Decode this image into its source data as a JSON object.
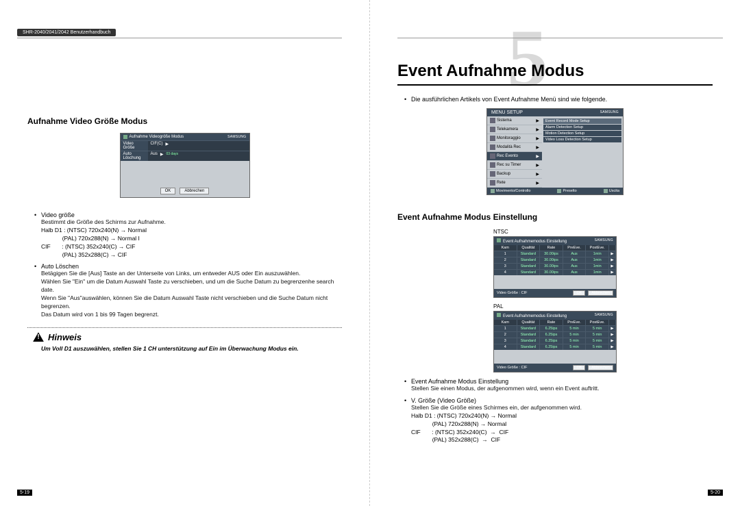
{
  "doc": {
    "header_label": "SHR-2040/2041/2042 Benutzerhandbuch",
    "chapter_number": "5",
    "chapter_title": "Event Aufnahme Modus",
    "page_left": "5-19",
    "page_right": "5-20"
  },
  "left": {
    "section1": "Aufnahme Video Größe Modus",
    "mock": {
      "title_icon": "rec-icon",
      "title": "Aufnahme Videogröße Modus",
      "brand": "SAMSUNG",
      "rows": [
        {
          "label": "Video Größe",
          "value": "CIF(C)",
          "arrow": "▶"
        },
        {
          "label": "Auto Löschung",
          "value": "Aus",
          "extra": "03 days",
          "arrow": "▶"
        }
      ],
      "ok": "OK",
      "cancel": "Abbrechen"
    },
    "bullets": {
      "video_size": {
        "h": "Video größe",
        "l1": "Bestimmt die Größe des Schirms zur Aufnahme.",
        "l2": "Halb D1 : (NTSC) 720x240(N) → Normal",
        "l3": "             (PAL) 720x288(N) → Normal I",
        "l4": "CIF       : (NTSC) 352x240(C) → CIF",
        "l5": "             (PAL) 352x288(C) → CIF"
      },
      "auto_del": {
        "h": "Auto Löschen",
        "l1": "Betägigen Sie die [Aus] Taste an der Unterseite von Links, um entweder AUS oder Ein auszuwählen.",
        "l2": "Wählen Sie \"Ein\" um die Datum Auswahl Taste zu verschieben, und um die Suche Datum zu begrenzenhe search date.",
        "l3": "Wenn Sie \"Aus\"auswählen, können Sie die Datum Auswahl Taste nicht verschieben und die Suche Datum nicht begrenzen.",
        "l4": "Das Datum wird von 1 bis 99 Tagen begrenzt."
      }
    },
    "hinweis": {
      "title": "Hinweis",
      "text": "Um Voll D1 auszuwählen, stellen Sie 1 CH unterstützung auf Ein im Überwachung Modus ein."
    }
  },
  "right": {
    "intro": "Die ausführlichen Artikels von Event Aufnahme Menü sind wie folgende.",
    "menu_mock": {
      "title": "MENU SETUP",
      "brand": "SAMSUNG",
      "items": [
        "Sistema",
        "Telekamera",
        "Monitoraggio",
        "Modalità Rec",
        "Rec Evento",
        "Rec su Timer",
        "Backup",
        "Rete"
      ],
      "popup": [
        "Event Record Mode Setup",
        "Alarm Detection Setup",
        "Motion Detection Setup",
        "Video Loss Detection Setup"
      ],
      "footer": [
        "Movimento/Controllo",
        "Preselto",
        "Uscita"
      ]
    },
    "section2": "Event Aufnahme Modus Einstellung",
    "label_ntsc": "NTSC",
    "label_pal": "PAL",
    "table_common": {
      "title": "Event Aufnahmemodus Einstellung",
      "brand": "SAMSUNG",
      "headers": [
        "Kam",
        "Qualität",
        "Rate",
        "PreEve.",
        "PostEve.",
        ""
      ],
      "footer_label": "Video Größe : CIF",
      "ok": "OK",
      "cancel": "Abbrechen"
    },
    "ntsc_rows": [
      [
        "1",
        "Standard",
        "30.00ips",
        "Aus",
        "1min",
        "▶"
      ],
      [
        "2",
        "Standard",
        "30.00ips",
        "Aus",
        "1min",
        "▶"
      ],
      [
        "3",
        "Standard",
        "30.00ips",
        "Aus",
        "1min",
        "▶"
      ],
      [
        "4",
        "Standard",
        "30.00ips",
        "Aus",
        "1min",
        "▶"
      ]
    ],
    "pal_rows": [
      [
        "1",
        "Standard",
        "6.25ips",
        "5 min",
        "5 min",
        "▶"
      ],
      [
        "2",
        "Standard",
        "6.25ips",
        "5 min",
        "5 min",
        "▶"
      ],
      [
        "3",
        "Standard",
        "6.25ips",
        "5 min",
        "5 min",
        "▶"
      ],
      [
        "4",
        "Standard",
        "6.25ips",
        "5 min",
        "5 min",
        "▶"
      ]
    ],
    "bullets": {
      "b1": {
        "h": "Event Aufnahme Modus Einstellung",
        "l1": "Stellen Sie einen Modus, der aufgenommen wird, wenn ein Event auftritt."
      },
      "b2": {
        "h": "V. Größe (Video Größe)",
        "l1": "Stellen Sie die Größe eines Schirmes ein, der aufgenommen wird.",
        "l2": "Halb D1 : (NTSC) 720x240(N) → Normal",
        "l3": "             (PAL) 720x288(N) → Normal",
        "l4": "CIF       : (NTSC) 352x240(C)  →  CIF",
        "l5": "             (PAL) 352x288(C)  →  CIF"
      }
    }
  }
}
